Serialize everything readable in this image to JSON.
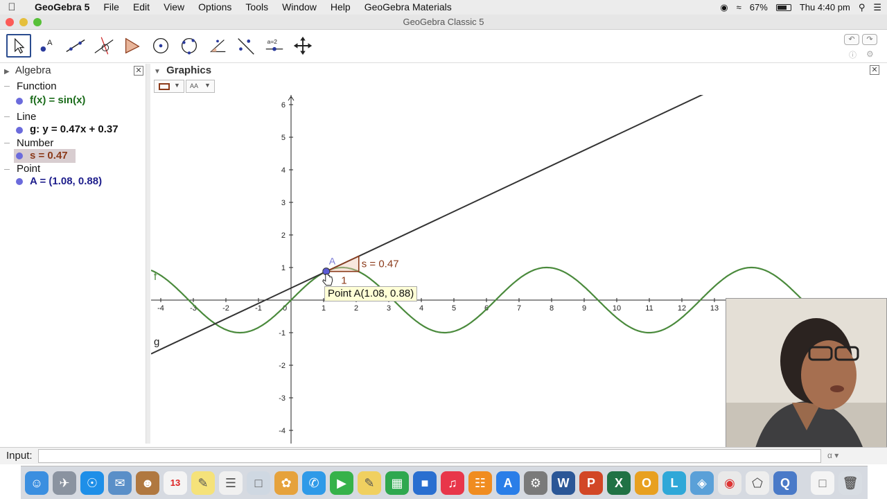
{
  "menubar": {
    "app_name": "GeoGebra 5",
    "items": [
      "File",
      "Edit",
      "View",
      "Options",
      "Tools",
      "Window",
      "Help",
      "GeoGebra Materials"
    ],
    "battery": "67%",
    "clock": "Thu 4:40 pm"
  },
  "window": {
    "title": "GeoGebra Classic 5"
  },
  "toolbar": {
    "tools": [
      "move-tool",
      "point-tool",
      "line-tool",
      "perpendicular-tool",
      "polygon-tool",
      "circle-tool",
      "conic-tool",
      "angle-tool",
      "reflect-tool",
      "slider-tool",
      "move-view-tool"
    ],
    "slider_label": "a=2"
  },
  "algebra": {
    "title": "Algebra",
    "categories": [
      {
        "name": "Function",
        "item": "f(x) = sin(x)",
        "color": "#1a6b1a"
      },
      {
        "name": "Line",
        "item": "g: y = 0.47x + 0.37",
        "color": "#111111"
      },
      {
        "name": "Number",
        "item": "s = 0.47",
        "color": "#8b3a1a"
      },
      {
        "name": "Point",
        "item": "A = (1.08, 0.88)",
        "color": "#1e1e8c"
      }
    ]
  },
  "graphics": {
    "title": "Graphics",
    "style_label": "AA",
    "x_ticks": [
      "-4",
      "-3",
      "-2",
      "-1",
      "0",
      "1",
      "2",
      "3",
      "4",
      "5",
      "6",
      "7",
      "8",
      "9",
      "10",
      "11",
      "12",
      "13"
    ],
    "y_ticks": [
      "6",
      "5",
      "4",
      "3",
      "2",
      "1",
      "-1",
      "-2",
      "-3",
      "-4"
    ],
    "function_label": "f",
    "line_label": "g",
    "point_label": "A",
    "slope_label": "s = 0.47",
    "slope_run_label": "1",
    "tooltip": "Point A(1.08, 0.88)",
    "colors": {
      "function": "#4a8a3c",
      "line": "#333333",
      "point": "#5b5bd6",
      "slope": "#8b3a1a"
    }
  },
  "input": {
    "label": "Input:",
    "value": ""
  }
}
